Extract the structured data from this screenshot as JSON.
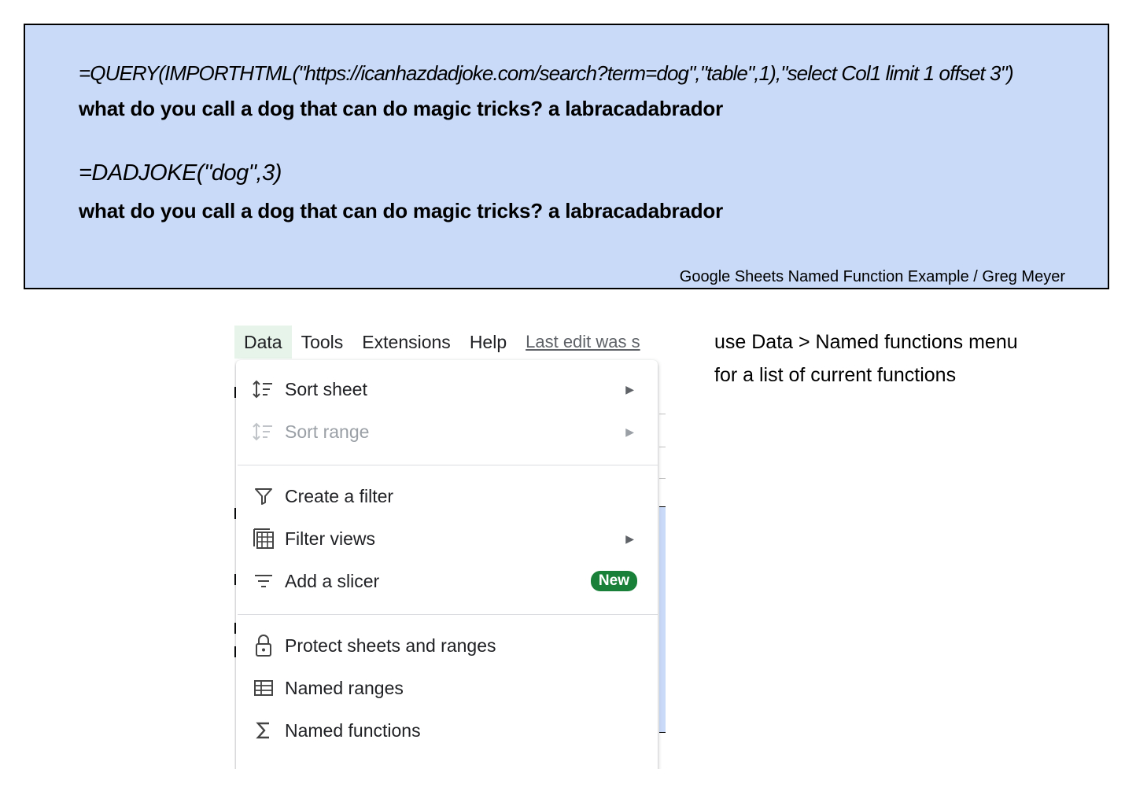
{
  "banner": {
    "formula_1": "=QUERY(IMPORTHTML(\"https://icanhazdadjoke.com/search?term=dog\",\"table\",1),\"select Col1 limit 1 offset 3\")",
    "result_1": "what do you call a dog that can do magic tricks? a labracadabrador",
    "formula_2": "=DADJOKE(\"dog\",3)",
    "result_2": "what do you call a dog that can do magic tricks? a labracadabrador",
    "credit": "Google Sheets Named Function Example / Greg Meyer",
    "background_color": "#c9daf8"
  },
  "menubar": {
    "items": [
      "Data",
      "Tools",
      "Extensions",
      "Help"
    ],
    "active": "Data",
    "last_edit": "Last edit was s"
  },
  "data_menu": {
    "items": [
      {
        "label": "Sort sheet",
        "icon": "sort-icon",
        "submenu": true,
        "enabled": true
      },
      {
        "label": "Sort range",
        "icon": "sort-icon",
        "submenu": true,
        "enabled": false
      },
      {
        "label": "Create a filter",
        "icon": "filter-icon",
        "submenu": false,
        "enabled": true
      },
      {
        "label": "Filter views",
        "icon": "filter-views-icon",
        "submenu": true,
        "enabled": true
      },
      {
        "label": "Add a slicer",
        "icon": "slicer-icon",
        "badge": "New",
        "enabled": true
      },
      {
        "label": "Protect sheets and ranges",
        "icon": "lock-icon",
        "enabled": true
      },
      {
        "label": "Named ranges",
        "icon": "named-ranges-icon",
        "enabled": true
      },
      {
        "label": "Named functions",
        "icon": "sigma-icon",
        "enabled": true
      }
    ],
    "badge_color": "#188038"
  },
  "note": {
    "line_1": "use Data > Named functions menu",
    "line_2": "for a list of current functions"
  }
}
